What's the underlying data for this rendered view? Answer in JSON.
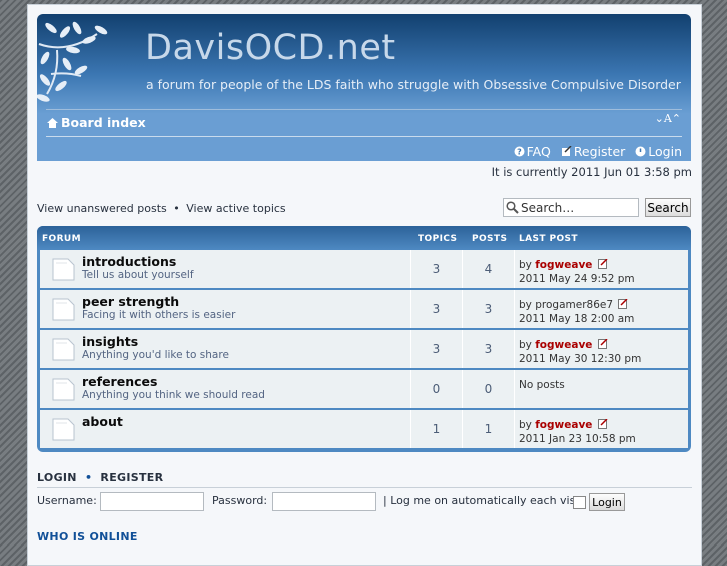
{
  "header": {
    "site_title": "DavisOCD.net",
    "site_description": "a forum for people of the LDS faith who struggle with Obsessive Compulsive Disorder",
    "logo_icon": "leafy-branch-icon"
  },
  "nav": {
    "board_index": "Board index",
    "font_size": "⌄A⌃",
    "faq": "FAQ",
    "register": "Register",
    "login": "Login"
  },
  "current_time": "It is currently 2011 Jun 01 3:58 pm",
  "quicklinks": {
    "unanswered": "View unanswered posts",
    "separator": "•",
    "active": "View active topics"
  },
  "search": {
    "value": "Search…",
    "button": "Search"
  },
  "forum_table": {
    "headers": {
      "forum": "FORUM",
      "topics": "TOPICS",
      "posts": "POSTS",
      "last_post": "LAST POST"
    },
    "rows": [
      {
        "title": "introductions",
        "description": "Tell us about yourself",
        "topics": "3",
        "posts": "4",
        "by": "by",
        "author": "fogweave",
        "author_highlight": true,
        "date": "2011 May 24 9:52 pm"
      },
      {
        "title": "peer strength",
        "description": "Facing it with others is easier",
        "topics": "3",
        "posts": "3",
        "by": "by",
        "author": "progamer86e7",
        "author_highlight": false,
        "date": "2011 May 18 2:00 am"
      },
      {
        "title": "insights",
        "description": "Anything you'd like to share",
        "topics": "3",
        "posts": "3",
        "by": "by",
        "author": "fogweave",
        "author_highlight": true,
        "date": "2011 May 30 12:30 pm"
      },
      {
        "title": "references",
        "description": "Anything you think we should read",
        "topics": "0",
        "posts": "0",
        "by": "",
        "author": "",
        "author_highlight": false,
        "date": "No posts"
      },
      {
        "title": "about",
        "description": "",
        "topics": "1",
        "posts": "1",
        "by": "by",
        "author": "fogweave",
        "author_highlight": true,
        "date": "2011 Jan 23 10:58 pm"
      }
    ]
  },
  "login": {
    "login_heading": "LOGIN",
    "bullet": "•",
    "register_heading": "REGISTER",
    "username_label": "Username:",
    "password_label": "Password:",
    "autologin_label": "| Log me on automatically each visit",
    "button": "Login"
  },
  "who_is_online": "WHO IS ONLINE",
  "colors": {
    "header_dark": "#12406f",
    "header_light": "#6a9ed3",
    "row_bg": "#ecf1f3",
    "author": "#aa0000",
    "link": "#115098"
  }
}
